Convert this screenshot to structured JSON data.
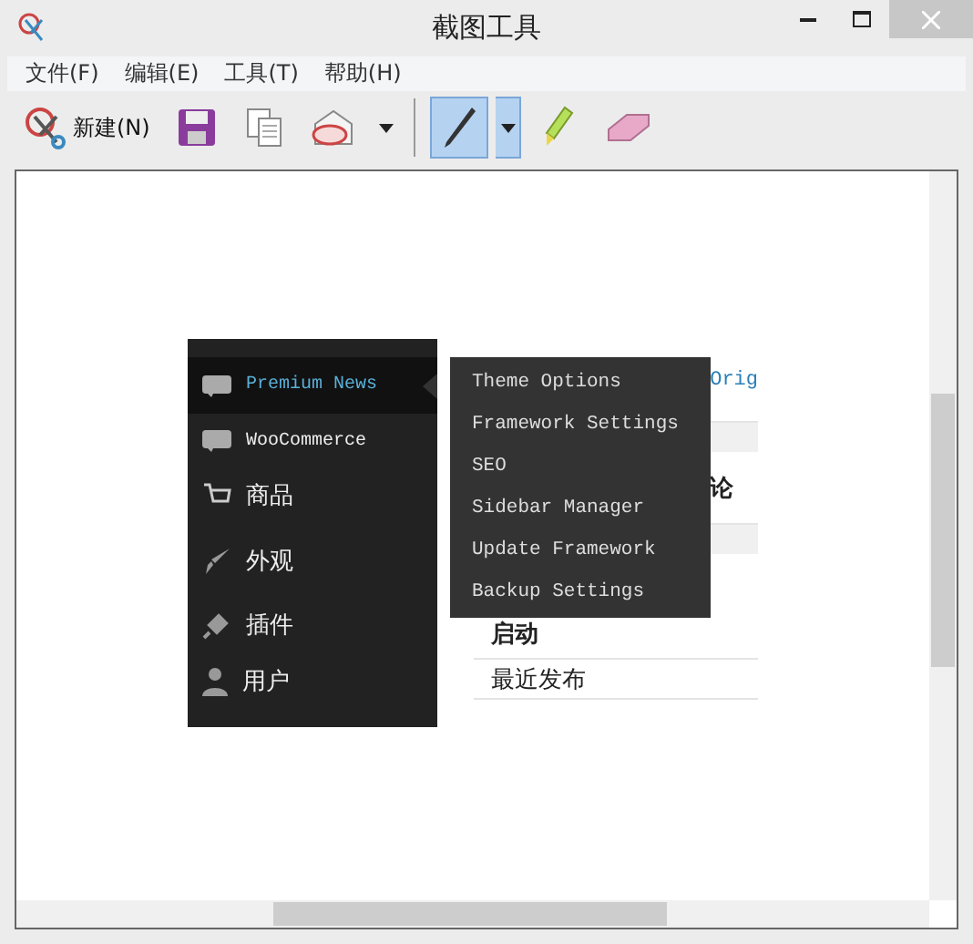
{
  "window": {
    "title": "截图工具"
  },
  "menu": [
    "文件(F)",
    "编辑(E)",
    "工具(T)",
    "帮助(H)"
  ],
  "toolbar": [
    {
      "kind": "new",
      "label": "新建(N)",
      "selected": false
    },
    {
      "kind": "save",
      "selected": false
    },
    {
      "kind": "copy",
      "selected": false
    },
    {
      "kind": "send",
      "selected": false
    },
    {
      "kind": "pen",
      "selected": true
    },
    {
      "kind": "highlighter",
      "selected": false
    },
    {
      "kind": "eraser",
      "selected": false
    }
  ],
  "capture": {
    "sidebar": [
      {
        "kind": "woo",
        "label": "Premium News",
        "selected": true
      },
      {
        "kind": "woo",
        "label": "WooCommerce",
        "selected": false
      },
      {
        "kind": "cart",
        "label": "商品",
        "selected": false
      },
      {
        "kind": "brush",
        "label": "外观",
        "selected": false
      },
      {
        "kind": "plug",
        "label": "插件",
        "selected": false
      },
      {
        "kind": "user",
        "label": "用户",
        "selected": false
      }
    ],
    "submenu": [
      "Theme Options",
      "Framework Settings",
      "SEO",
      "Sidebar Manager",
      "Update Framework",
      "Backup Settings"
    ],
    "content": [
      {
        "kind": "link",
        "text": "Orig"
      },
      {
        "kind": "heading",
        "text": "论"
      },
      {
        "kind": "heading",
        "text": "启动"
      },
      {
        "kind": "plain",
        "text": "最近发布"
      }
    ]
  }
}
